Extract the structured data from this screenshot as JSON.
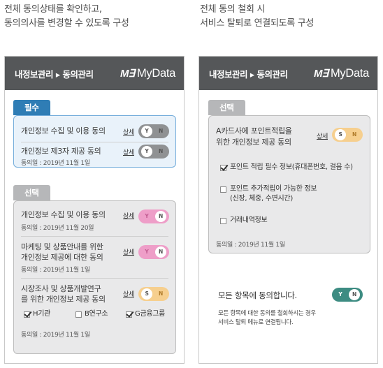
{
  "captions": {
    "left": [
      "전체 동의상태를 확인하고,",
      "동의의사를 변경할 수 있도록 구성"
    ],
    "right": [
      "전체 동의 철회 시",
      "서비스 탈퇴로 연결되도록 구성"
    ]
  },
  "appbar": {
    "title": "내정보관리 ▸ 동의관리",
    "logo": "M∃",
    "brand": "MyData"
  },
  "left": {
    "required_tab": "필수",
    "optional_tab": "선택",
    "required": [
      {
        "label": "개인정보 수집 및 이용 동의",
        "detail": "상세",
        "date": "",
        "on": "Y",
        "off": "N"
      },
      {
        "label": "개인정보 제3자 제공 동의",
        "detail": "상세",
        "date": "동의일 : 2019년 11월 1일",
        "on": "Y",
        "off": "N"
      }
    ],
    "optional": [
      {
        "label": [
          "개인정보 수집 및 이용 동의"
        ],
        "detail": "상세",
        "date": "동의일 : 2019년 11월 20일",
        "on": "Y",
        "off": "N"
      },
      {
        "label": [
          "마케팅 및 상품안내를 위한",
          "개인정보 제공에 대한 동의"
        ],
        "detail": "상세",
        "date": "동의일 : 2019년 11월 1일",
        "on": "Y",
        "off": "N"
      },
      {
        "label": [
          "시장조사 및 상품개발연구",
          "를 위한 개인정보 제공 동의"
        ],
        "detail": "상세",
        "date": "동의일 : 2019년 11월 1일",
        "on": "S",
        "off": "N"
      }
    ],
    "checkboxes": [
      {
        "label": "H기관",
        "checked": true
      },
      {
        "label": "B연구소",
        "checked": false
      },
      {
        "label": "G금융그룹",
        "checked": true
      }
    ]
  },
  "right": {
    "optional_tab": "선택",
    "item": {
      "label": [
        "A카드사에 포인트적립을",
        "위한 개인정보 제공 동의"
      ],
      "detail": "상세",
      "on": "S",
      "off": "N"
    },
    "checkboxes": [
      {
        "label": [
          "포인트 적립 필수 정보(휴대폰번호, 걸음 수)"
        ],
        "checked": true
      },
      {
        "label": [
          "포인트 추가적립이 가능한 정보",
          "(신장, 체중, 수면시간)"
        ],
        "checked": false
      },
      {
        "label": [
          "거래내역정보"
        ],
        "checked": false
      }
    ],
    "date": "동의일 : 2019년 11월 1일",
    "all_agree": {
      "label": "모든 항목에 동의합니다.",
      "on": "Y",
      "off": "N"
    },
    "note": [
      "모든 항목에 대한 동의를 철회하시는 경우",
      "서비스 탈퇴 메뉴로 연결됩니다."
    ]
  },
  "colors": {
    "appbar": "#555759",
    "required_tab": "#2f7db5",
    "toggle_gray": "#8f9193",
    "toggle_pink": "#ee9ec8",
    "toggle_orange": "#f6cf8e",
    "toggle_teal": "#3d8c82"
  }
}
